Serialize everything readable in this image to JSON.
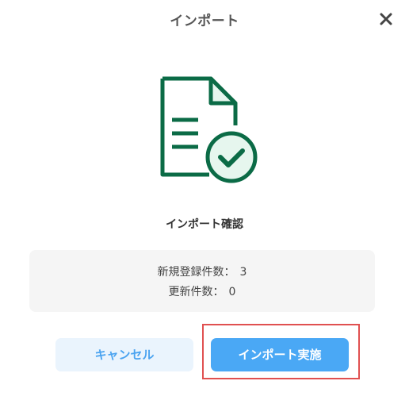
{
  "dialog": {
    "title": "インポート",
    "close_icon": "close-icon"
  },
  "hero": {
    "icon": "document-check-icon",
    "colors": {
      "stroke": "#0b6b46",
      "fill": "#e6f6ee"
    }
  },
  "confirm": {
    "title": "インポート確認"
  },
  "summary": {
    "new_label": "新規登録件数：",
    "new_count": "3",
    "update_label": "更新件数：",
    "update_count": "0"
  },
  "buttons": {
    "cancel_label": "キャンセル",
    "import_label": "インポート実施"
  },
  "colors": {
    "primary": "#4aa8f5",
    "secondary_bg": "#eaf4fd",
    "highlight": "#e05050"
  }
}
